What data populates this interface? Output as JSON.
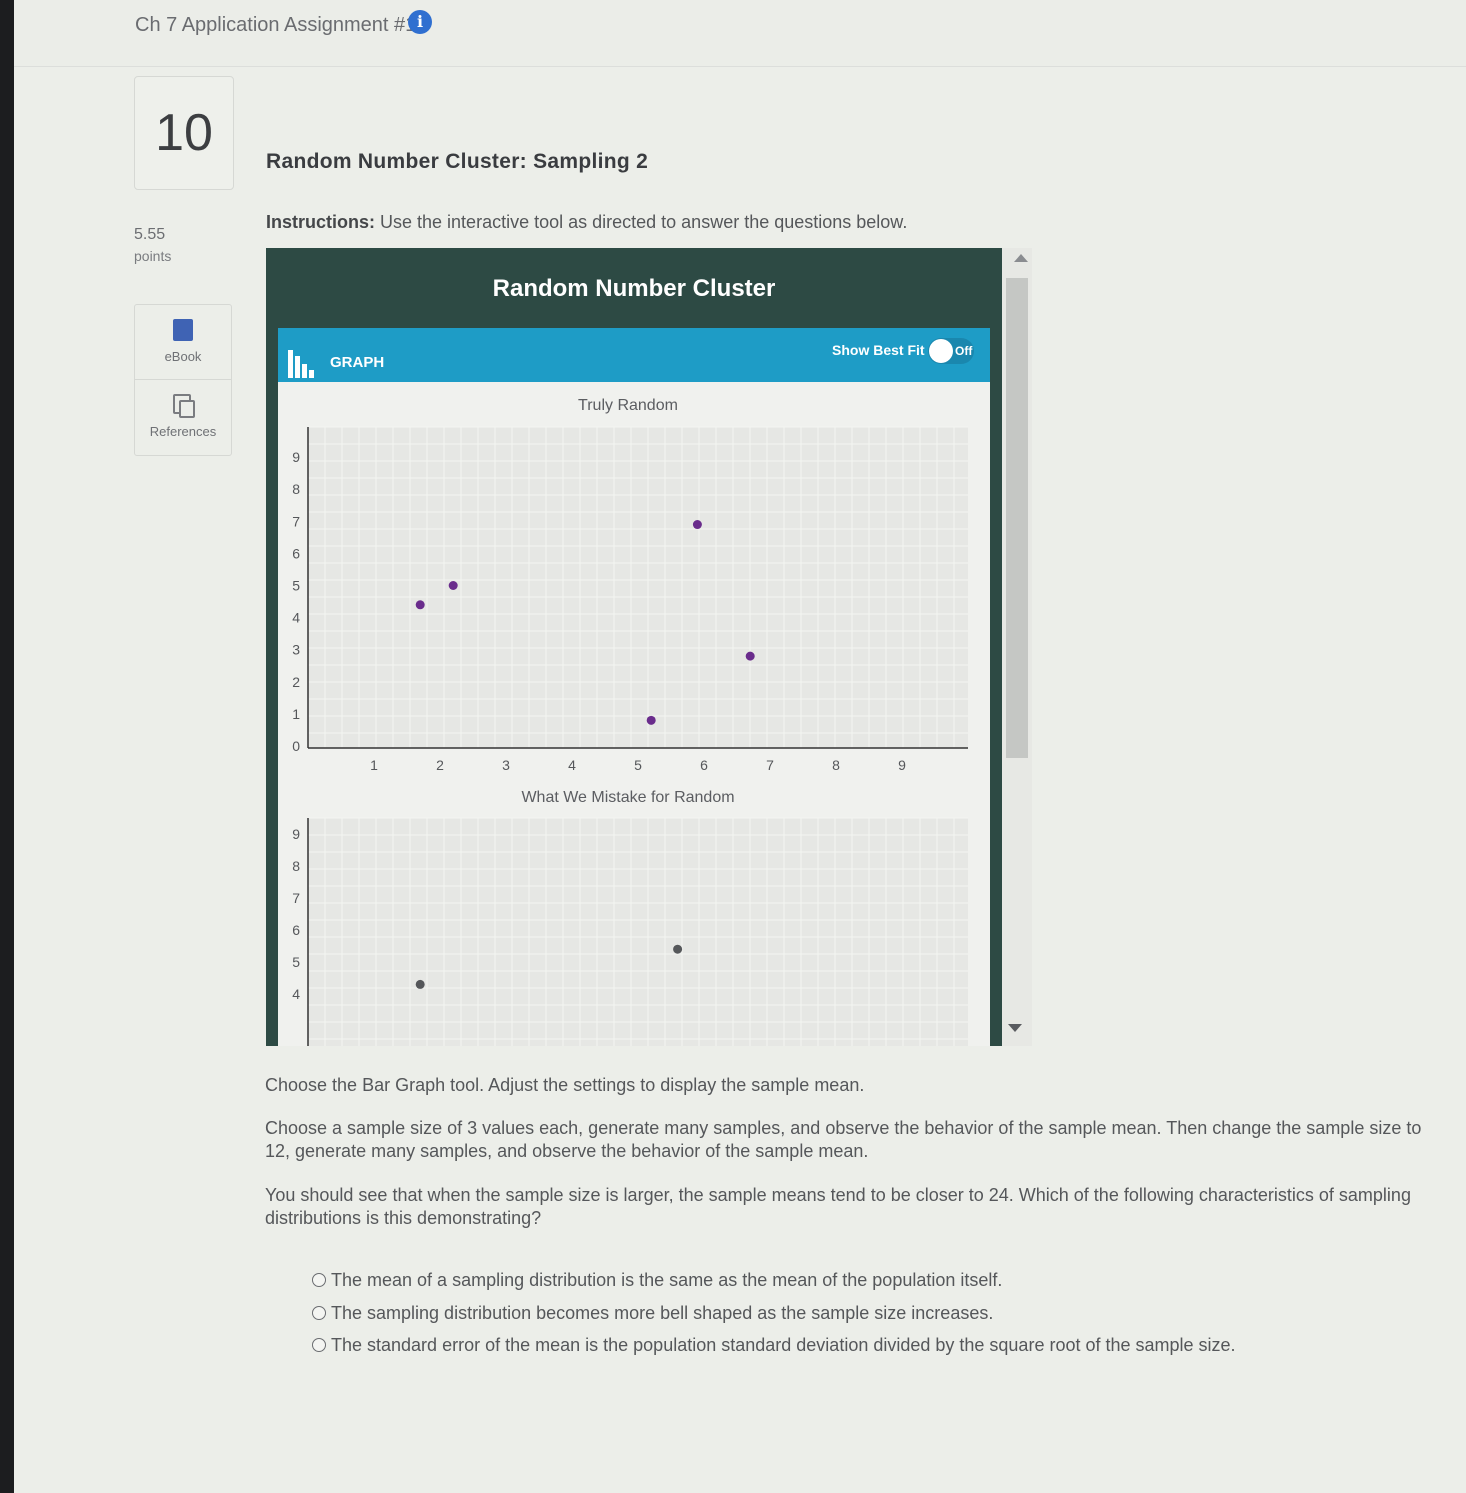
{
  "header": {
    "assignment_title": "Ch 7 Application Assignment #1",
    "info_icon": "info-icon"
  },
  "question": {
    "number": "10",
    "points_value": "5.55",
    "points_label": "points",
    "title": "Random Number Cluster: Sampling 2",
    "instructions_bold": "Instructions:",
    "instructions_text": " Use the interactive tool as directed to answer the questions below."
  },
  "side_tools": {
    "ebook_label": "eBook",
    "references_label": "References"
  },
  "widget": {
    "title": "Random Number Cluster",
    "graph_label": "GRAPH",
    "best_fit_label": "Show Best Fit",
    "toggle_state": "Off",
    "colors": {
      "header": "#2d4a44",
      "graph_bar": "#1e9cc6",
      "point_top": "#6a2c8c",
      "point_bottom": "#55575a"
    }
  },
  "chart_data": [
    {
      "type": "scatter",
      "title": "Truly Random",
      "xlabel": "",
      "ylabel": "",
      "x_ticks": [
        "1",
        "2",
        "3",
        "4",
        "5",
        "6",
        "7",
        "8",
        "9"
      ],
      "y_ticks": [
        "0",
        "1",
        "2",
        "3",
        "4",
        "5",
        "6",
        "7",
        "8",
        "9"
      ],
      "xlim": [
        0,
        10
      ],
      "ylim": [
        0,
        10
      ],
      "grid": true,
      "points": [
        {
          "x": 1.7,
          "y": 4.4
        },
        {
          "x": 2.2,
          "y": 5.0
        },
        {
          "x": 5.9,
          "y": 6.9
        },
        {
          "x": 6.7,
          "y": 2.8
        },
        {
          "x": 5.2,
          "y": 0.8
        }
      ]
    },
    {
      "type": "scatter",
      "title": "What We Mistake for Random",
      "xlabel": "",
      "ylabel": "",
      "y_ticks": [
        "4",
        "5",
        "6",
        "7",
        "8",
        "9"
      ],
      "xlim": [
        0,
        10
      ],
      "ylim": [
        3,
        10
      ],
      "grid": true,
      "points": [
        {
          "x": 1.7,
          "y": 4.3
        },
        {
          "x": 5.6,
          "y": 5.4
        }
      ]
    }
  ],
  "body": {
    "p1": "Choose the Bar Graph tool. Adjust the settings to display the sample mean.",
    "p2": "Choose a sample size of 3 values each, generate many samples, and observe the behavior of the sample mean. Then change the sample size to 12, generate many samples, and observe the behavior of the sample mean.",
    "p3": "You should see that when the sample size is larger, the sample means tend to be closer to 24. Which of the following characteristics of sampling distributions is this demonstrating?"
  },
  "options": [
    "The mean of a sampling distribution is the same as the mean of the population itself.",
    "The sampling distribution becomes more bell shaped as the sample size increases.",
    "The standard error of the mean is the population standard deviation divided by the square root of the sample size."
  ]
}
